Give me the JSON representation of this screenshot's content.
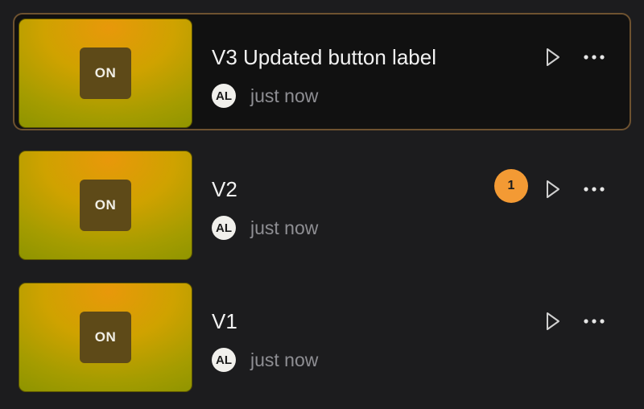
{
  "versions": [
    {
      "label": "V3 Updated button label",
      "thumbnail_text": "ON",
      "author_initials": "AL",
      "timestamp": "just now",
      "selected": true,
      "comment_count": null
    },
    {
      "label": "V2",
      "thumbnail_text": "ON",
      "author_initials": "AL",
      "timestamp": "just now",
      "selected": false,
      "comment_count": "1"
    },
    {
      "label": "V1",
      "thumbnail_text": "ON",
      "author_initials": "AL",
      "timestamp": "just now",
      "selected": false,
      "comment_count": null
    }
  ],
  "icons": {
    "play": "play-icon",
    "more": "more-horizontal-icon"
  },
  "colors": {
    "background": "#1c1c1e",
    "selected_row_bg": "#111111",
    "selected_border": "#6e5230",
    "badge": "#f39a34",
    "avatar_bg": "#f1f0ec",
    "muted_text": "#8e8e93",
    "chip_bg": "#5e4a18"
  }
}
